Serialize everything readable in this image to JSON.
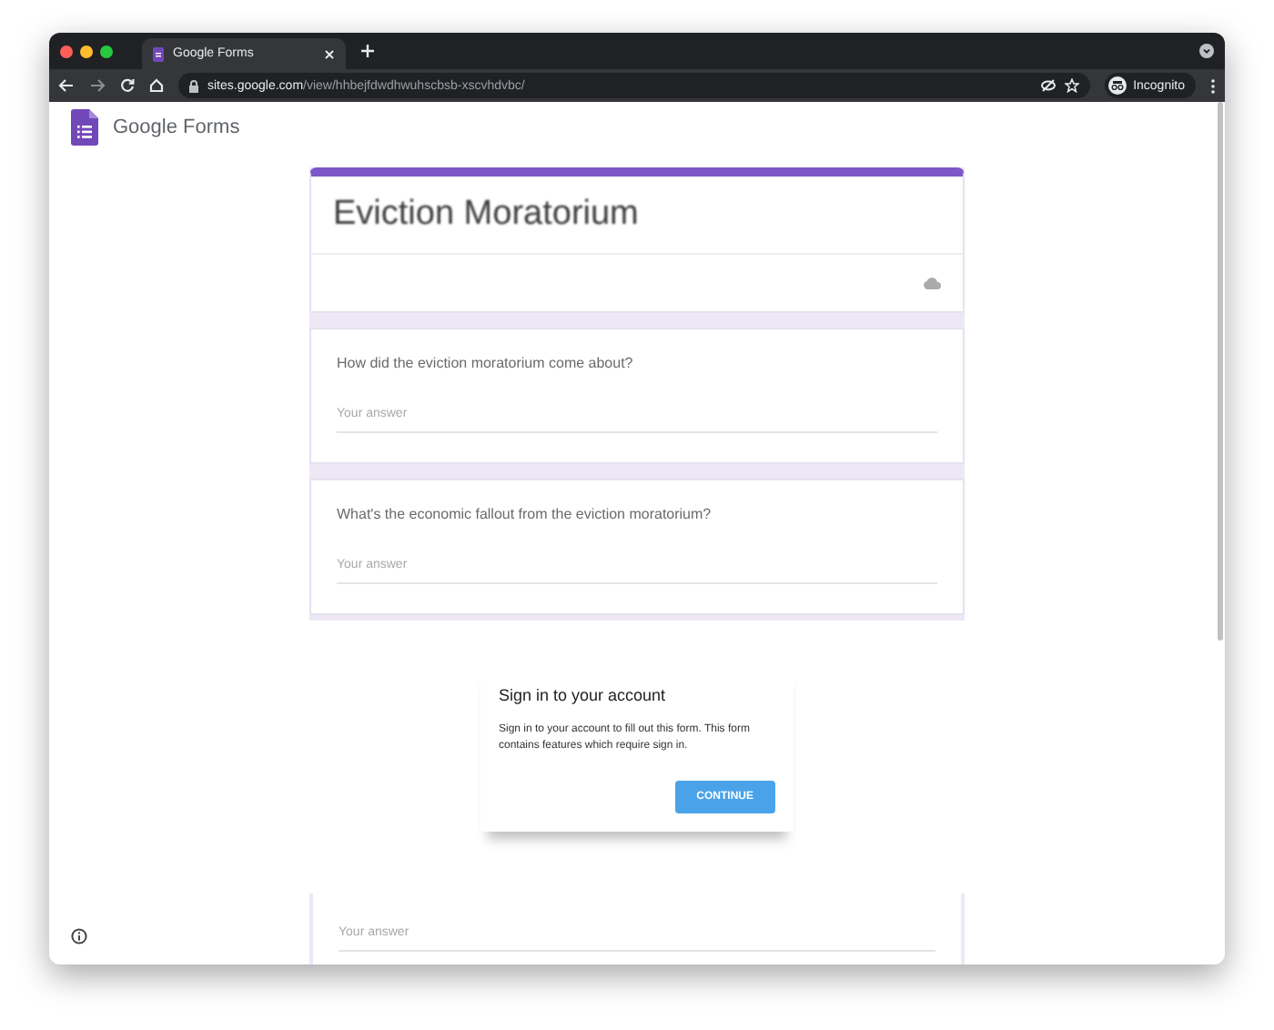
{
  "browser": {
    "tab": {
      "title": "Google Forms"
    },
    "url": {
      "domain": "sites.google.com",
      "path": "/view/hhbejfdwdhwuhscbsb-xscvhdvbc/"
    },
    "profile": "Incognito"
  },
  "app": {
    "name": "Google Forms"
  },
  "form": {
    "title": "Eviction Moratorium",
    "questions": [
      {
        "text": "How did the eviction moratorium come about?",
        "placeholder": "Your answer"
      },
      {
        "text": "What's the economic fallout from the eviction moratorium?",
        "placeholder": "Your answer"
      }
    ],
    "trailing_field": {
      "placeholder": "Your answer"
    }
  },
  "dialog": {
    "title": "Sign in to your account",
    "message": "Sign in to your account to fill out this form. This form contains features which require sign in.",
    "button": "CONTINUE"
  }
}
